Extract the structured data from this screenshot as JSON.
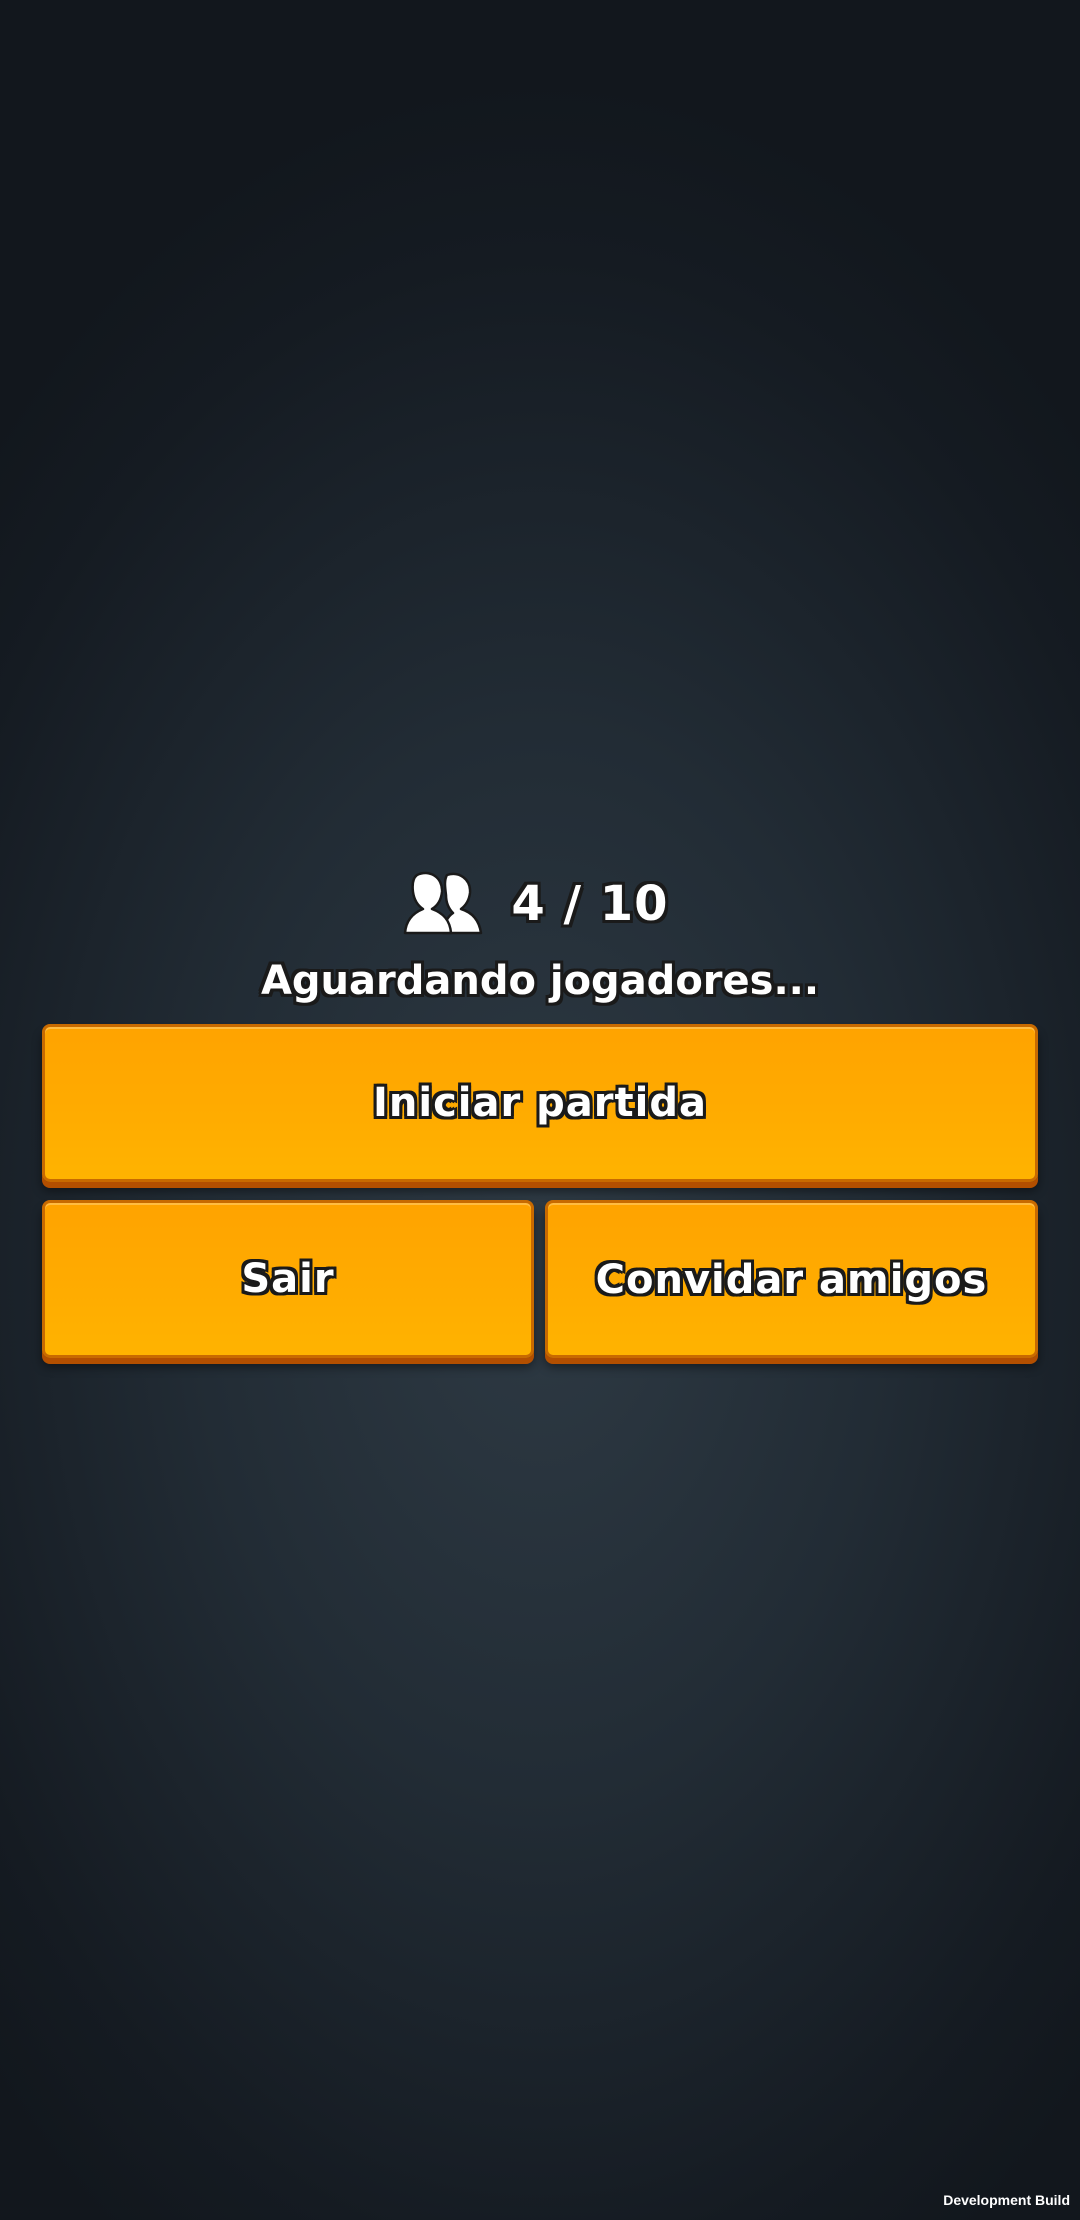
{
  "lobby": {
    "icon": "players-icon",
    "player_count": "4 / 10",
    "players_current": 4,
    "players_max": 10,
    "status": "Aguardando jogadores..."
  },
  "buttons": {
    "start_label": "Iniciar partida",
    "leave_label": "Sair",
    "invite_label": "Convidar amigos"
  },
  "footer": {
    "build_label": "Development Build"
  },
  "colors": {
    "button_fill": "#ffa800",
    "button_border": "#c86a00",
    "background": "#1c242c",
    "text": "#ffffff"
  }
}
